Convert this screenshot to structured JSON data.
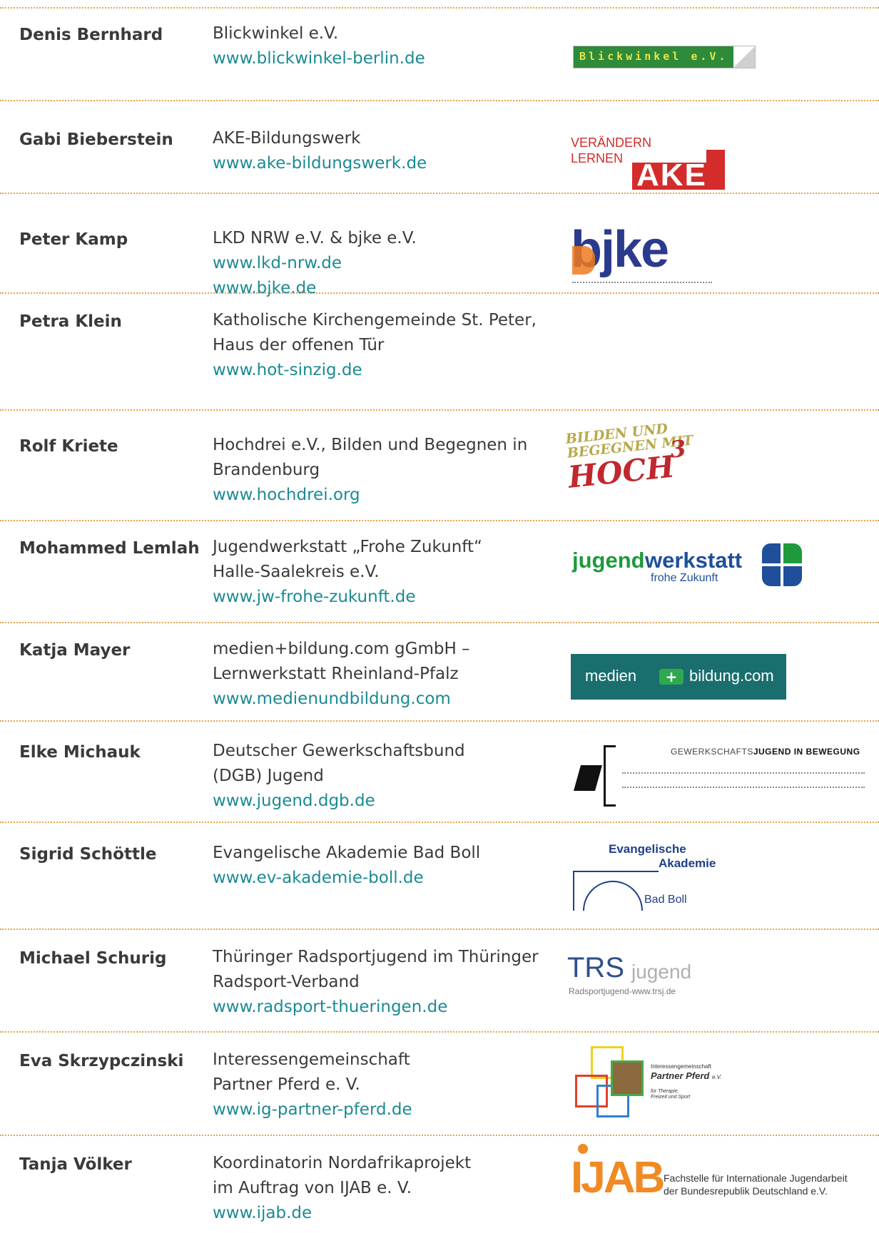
{
  "rows": [
    {
      "name": "Denis Bernhard",
      "org": [
        "Blickwinkel e.V."
      ],
      "links": [
        "www.blickwinkel-berlin.de"
      ],
      "logo": "Blickwinkel e.V."
    },
    {
      "name": "Gabi Bieberstein",
      "org": [
        "AKE-Bildungswerk"
      ],
      "links": [
        "www.ake-bildungswerk.de"
      ],
      "logo": {
        "line1": "VERÄNDERN",
        "line2": "LERNEN",
        "mark": "AKE"
      }
    },
    {
      "name": "Peter Kamp",
      "org": [
        "LKD NRW e.V. & bjke e.V."
      ],
      "links": [
        "www.lkd-nrw.de",
        "www.bjke.de"
      ],
      "logo": "bjke"
    },
    {
      "name": "Petra Klein",
      "org": [
        "Katholische Kirchengemeinde St. Peter,",
        "Haus der offenen Tür"
      ],
      "links": [
        "www.hot-sinzig.de"
      ]
    },
    {
      "name": "Rolf Kriete",
      "org": [
        "Hochdrei e.V., Bilden und Begegnen in",
        "Brandenburg"
      ],
      "links": [
        "www.hochdrei.org"
      ],
      "logo": {
        "line1": "BILDEN UND",
        "line2": "BEGEGNEN MIT",
        "line3": "HOCH",
        "sup": "3"
      }
    },
    {
      "name": "Mohammed Lemlah",
      "org": [
        "Jugendwerkstatt „Frohe Zukunft“",
        "Halle-Saalekreis e.V."
      ],
      "links": [
        "www.jw-frohe-zukunft.de"
      ],
      "logo": {
        "a": "jugend",
        "b": "werkstatt",
        "sub": "frohe Zukunft"
      }
    },
    {
      "name": "Katja Mayer",
      "org": [
        "medien+bildung.com gGmbH –",
        "Lernwerkstatt Rheinland-Pfalz"
      ],
      "links": [
        "www.medienundbildung.com"
      ],
      "logo": {
        "a": "medien",
        "b": "bildung.com"
      }
    },
    {
      "name": "Elke Michauk",
      "org": [
        "Deutscher Gewerkschaftsbund",
        "(DGB) Jugend"
      ],
      "links": [
        "www.jugend.dgb.de"
      ],
      "logo": {
        "a": "GEWERKSCHAFTS",
        "b": "JUGEND IN BEWEGUNG"
      }
    },
    {
      "name": "Sigrid Schöttle",
      "org": [
        "Evangelische Akademie Bad Boll"
      ],
      "links": [
        "www.ev-akademie-boll.de"
      ],
      "logo": {
        "line1": "Evangelische",
        "line2": "Akademie",
        "line3": "Bad Boll"
      }
    },
    {
      "name": "Michael Schurig",
      "org": [
        "Thüringer Radsportjugend im Thüringer",
        "Radsport-Verband"
      ],
      "links": [
        "www.radsport-thueringen.de"
      ],
      "logo": {
        "a": "TRS",
        "b": "jugend",
        "sub": "Radsportjugend-www.trsj.de"
      }
    },
    {
      "name": "Eva Skrzypczinski",
      "org": [
        "Interessengemeinschaft",
        "Partner Pferd e. V."
      ],
      "links": [
        "www.ig-partner-pferd.de"
      ],
      "logo": {
        "line1": "Interessengemeinschaft",
        "line2": "Partner Pferd",
        "suffix": "e.V.",
        "line3": "für Therapie,",
        "line4": "Freizeit und Sport"
      }
    },
    {
      "name": "Tanja Völker",
      "org": [
        "Koordinatorin Nordafrikaprojekt",
        "im Auftrag von IJAB e. V."
      ],
      "links": [
        "www.ijab.de"
      ],
      "logo": {
        "mark": "IJAB",
        "line1": "Fachstelle für Internationale Jugendarbeit",
        "line2": "der Bundesrepublik Deutschland e.V."
      }
    }
  ],
  "colors": {
    "link": "#1b8a93",
    "separator": "#e8a24a",
    "text": "#3a3a3a"
  }
}
